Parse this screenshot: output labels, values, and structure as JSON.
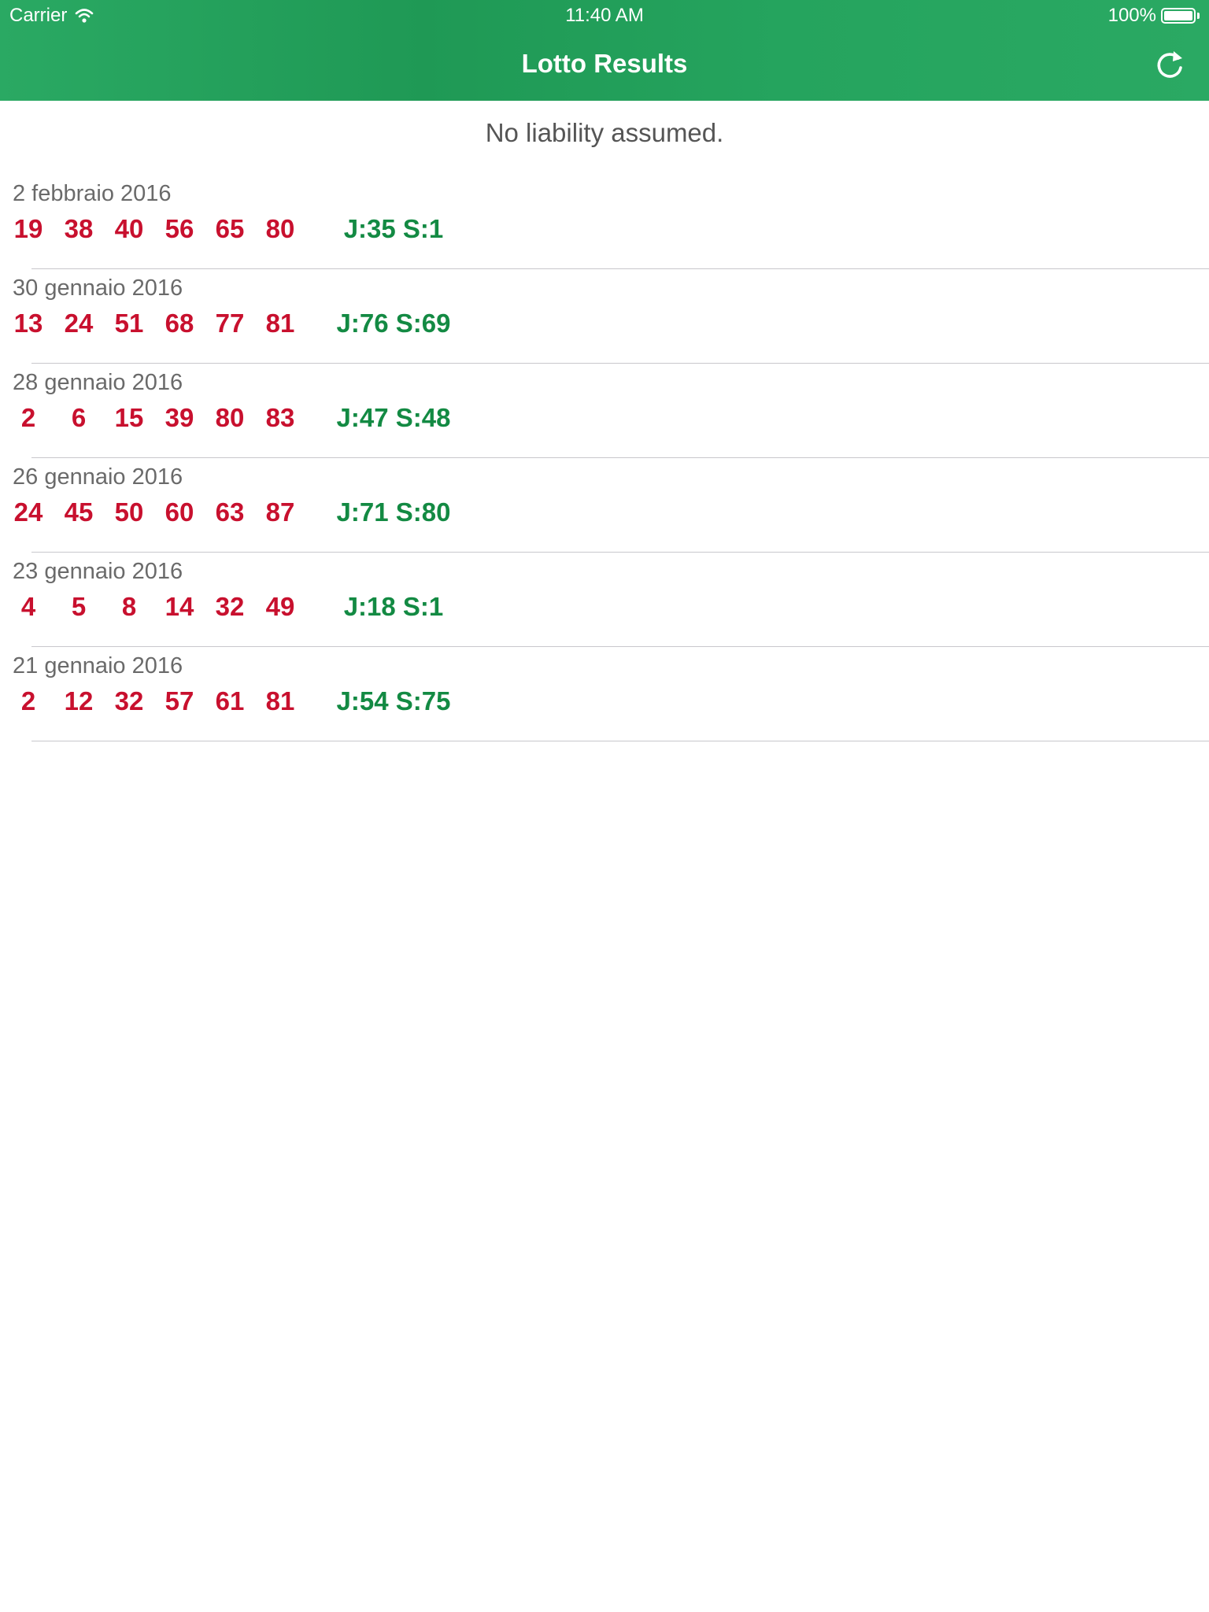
{
  "status_bar": {
    "carrier": "Carrier",
    "time": "11:40 AM",
    "battery": "100%"
  },
  "nav": {
    "title": "Lotto Results",
    "refresh_icon": "refresh-icon"
  },
  "disclaimer": "No liability assumed.",
  "colors": {
    "header_green": "#25a45e",
    "number_red": "#c8102e",
    "extra_green": "#138a43"
  },
  "results": [
    {
      "date": "2 febbraio 2016",
      "numbers": [
        "19",
        "38",
        "40",
        "56",
        "65",
        "80"
      ],
      "extra": "J:35 S:1"
    },
    {
      "date": "30 gennaio 2016",
      "numbers": [
        "13",
        "24",
        "51",
        "68",
        "77",
        "81"
      ],
      "extra": "J:76 S:69"
    },
    {
      "date": "28 gennaio 2016",
      "numbers": [
        "2",
        "6",
        "15",
        "39",
        "80",
        "83"
      ],
      "extra": "J:47 S:48"
    },
    {
      "date": "26 gennaio 2016",
      "numbers": [
        "24",
        "45",
        "50",
        "60",
        "63",
        "87"
      ],
      "extra": "J:71 S:80"
    },
    {
      "date": "23 gennaio 2016",
      "numbers": [
        "4",
        "5",
        "8",
        "14",
        "32",
        "49"
      ],
      "extra": "J:18 S:1"
    },
    {
      "date": "21 gennaio 2016",
      "numbers": [
        "2",
        "12",
        "32",
        "57",
        "61",
        "81"
      ],
      "extra": "J:54 S:75"
    }
  ]
}
